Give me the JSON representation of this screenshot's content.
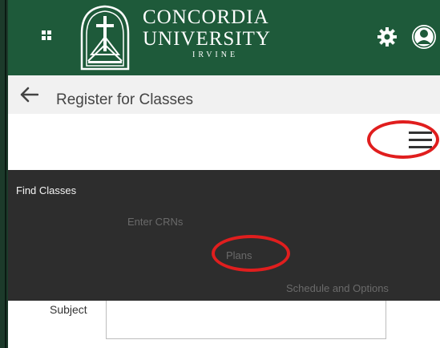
{
  "header": {
    "brand_line1": "CONCORDIA",
    "brand_line2": "UNIVERSITY",
    "brand_line3": "IRVINE",
    "apps_icon": "grid-icon",
    "settings_icon": "gear-icon",
    "profile_icon": "user-icon",
    "bg_color": "#1e5a3a"
  },
  "page": {
    "title": "Register for Classes",
    "back_icon": "arrow-left-icon"
  },
  "menu_toggle": {
    "icon": "hamburger-icon"
  },
  "menu": {
    "items": [
      {
        "label": "Find Classes"
      },
      {
        "label": "Enter CRNs"
      },
      {
        "label": "Plans"
      },
      {
        "label": "Schedule and Options"
      }
    ],
    "bg_color": "#2d2d2d"
  },
  "form": {
    "subject_label": "Subject",
    "subject_value": ""
  },
  "annotations": {
    "color": "#e01e1e"
  }
}
